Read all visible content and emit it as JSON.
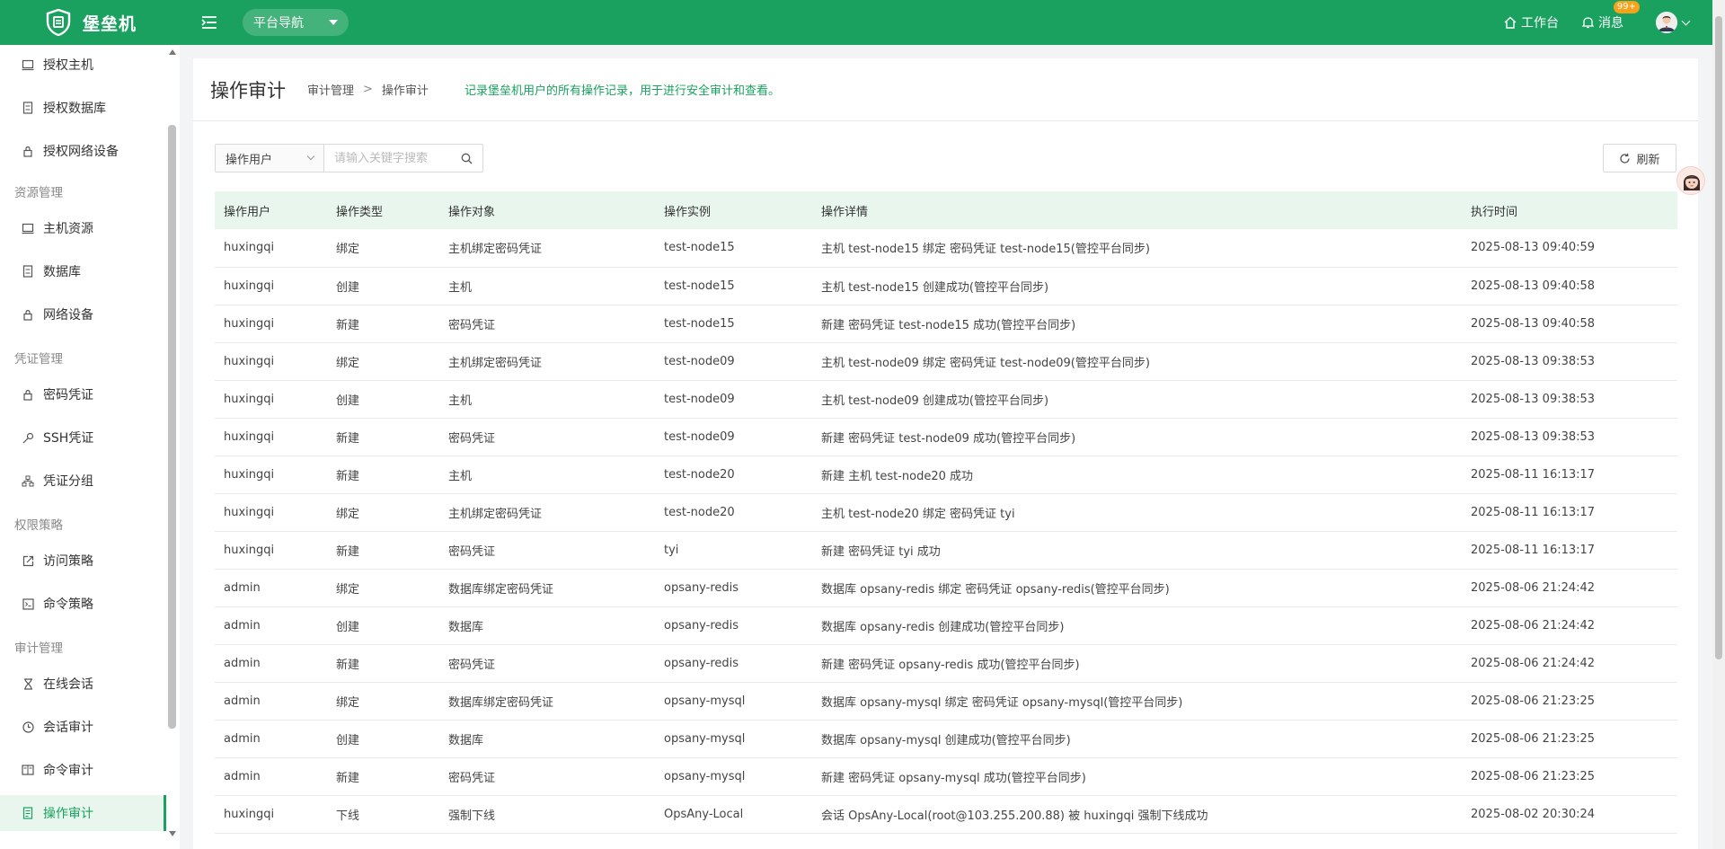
{
  "app": {
    "name": "堡垒机"
  },
  "header": {
    "platform_nav": "平台导航",
    "workbench": "工作台",
    "messages": "消息",
    "message_badge": "99+"
  },
  "sidebar": {
    "items": [
      {
        "label": "授权主机",
        "icon": "monitor-icon"
      },
      {
        "label": "授权数据库",
        "icon": "database-icon"
      },
      {
        "label": "授权网络设备",
        "icon": "lock-icon"
      },
      {
        "group": "资源管理"
      },
      {
        "label": "主机资源",
        "icon": "monitor-icon"
      },
      {
        "label": "数据库",
        "icon": "database-icon"
      },
      {
        "label": "网络设备",
        "icon": "lock-icon"
      },
      {
        "group": "凭证管理"
      },
      {
        "label": "密码凭证",
        "icon": "lock-icon"
      },
      {
        "label": "SSH凭证",
        "icon": "key-icon"
      },
      {
        "label": "凭证分组",
        "icon": "hierarchy-icon"
      },
      {
        "group": "权限策略"
      },
      {
        "label": "访问策略",
        "icon": "external-link-icon"
      },
      {
        "label": "命令策略",
        "icon": "terminal-icon"
      },
      {
        "group": "审计管理"
      },
      {
        "label": "在线会话",
        "icon": "hourglass-icon"
      },
      {
        "label": "会话审计",
        "icon": "clock-icon"
      },
      {
        "label": "命令审计",
        "icon": "book-icon"
      },
      {
        "label": "操作审计",
        "icon": "document-icon",
        "active": true
      }
    ]
  },
  "page": {
    "title": "操作审计",
    "breadcrumb": [
      "审计管理",
      "操作审计"
    ],
    "breadcrumb_sep": ">",
    "description": "记录堡垒机用户的所有操作记录，用于进行安全审计和查看。"
  },
  "filter": {
    "field": "操作用户",
    "placeholder": "请输入关键字搜索",
    "refresh": "刷新"
  },
  "table": {
    "columns": [
      "操作用户",
      "操作类型",
      "操作对象",
      "操作实例",
      "操作详情",
      "执行时间"
    ],
    "rows": [
      [
        "huxingqi",
        "绑定",
        "主机绑定密码凭证",
        "test-node15",
        "主机 test-node15 绑定 密码凭证 test-node15(管控平台同步)",
        "2025-08-13 09:40:59"
      ],
      [
        "huxingqi",
        "创建",
        "主机",
        "test-node15",
        "主机 test-node15 创建成功(管控平台同步)",
        "2025-08-13 09:40:58"
      ],
      [
        "huxingqi",
        "新建",
        "密码凭证",
        "test-node15",
        "新建 密码凭证 test-node15 成功(管控平台同步)",
        "2025-08-13 09:40:58"
      ],
      [
        "huxingqi",
        "绑定",
        "主机绑定密码凭证",
        "test-node09",
        "主机 test-node09 绑定 密码凭证 test-node09(管控平台同步)",
        "2025-08-13 09:38:53"
      ],
      [
        "huxingqi",
        "创建",
        "主机",
        "test-node09",
        "主机 test-node09 创建成功(管控平台同步)",
        "2025-08-13 09:38:53"
      ],
      [
        "huxingqi",
        "新建",
        "密码凭证",
        "test-node09",
        "新建 密码凭证 test-node09 成功(管控平台同步)",
        "2025-08-13 09:38:53"
      ],
      [
        "huxingqi",
        "新建",
        "主机",
        "test-node20",
        "新建 主机 test-node20 成功",
        "2025-08-11 16:13:17"
      ],
      [
        "huxingqi",
        "绑定",
        "主机绑定密码凭证",
        "test-node20",
        "主机 test-node20 绑定 密码凭证 tyi",
        "2025-08-11 16:13:17"
      ],
      [
        "huxingqi",
        "新建",
        "密码凭证",
        "tyi",
        "新建 密码凭证 tyi 成功",
        "2025-08-11 16:13:17"
      ],
      [
        "admin",
        "绑定",
        "数据库绑定密码凭证",
        "opsany-redis",
        "数据库 opsany-redis 绑定 密码凭证 opsany-redis(管控平台同步)",
        "2025-08-06 21:24:42"
      ],
      [
        "admin",
        "创建",
        "数据库",
        "opsany-redis",
        "数据库 opsany-redis 创建成功(管控平台同步)",
        "2025-08-06 21:24:42"
      ],
      [
        "admin",
        "新建",
        "密码凭证",
        "opsany-redis",
        "新建 密码凭证 opsany-redis 成功(管控平台同步)",
        "2025-08-06 21:24:42"
      ],
      [
        "admin",
        "绑定",
        "数据库绑定密码凭证",
        "opsany-mysql",
        "数据库 opsany-mysql 绑定 密码凭证 opsany-mysql(管控平台同步)",
        "2025-08-06 21:23:25"
      ],
      [
        "admin",
        "创建",
        "数据库",
        "opsany-mysql",
        "数据库 opsany-mysql 创建成功(管控平台同步)",
        "2025-08-06 21:23:25"
      ],
      [
        "admin",
        "新建",
        "密码凭证",
        "opsany-mysql",
        "新建 密码凭证 opsany-mysql 成功(管控平台同步)",
        "2025-08-06 21:23:25"
      ],
      [
        "huxingqi",
        "下线",
        "强制下线",
        "OpsAny-Local",
        "会话 OpsAny-Local(root@103.255.200.88) 被 huxingqi 强制下线成功",
        "2025-08-02 20:30:24"
      ]
    ]
  },
  "colors": {
    "brand": "#1aa15f",
    "header_row": "#e8f6ee",
    "badge": "#f7a21b"
  }
}
